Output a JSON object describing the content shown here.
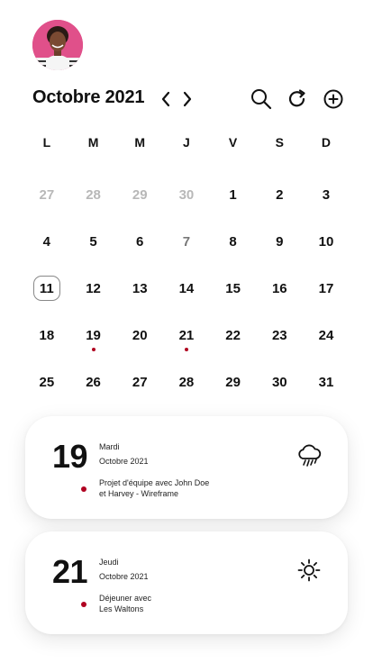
{
  "profile": {
    "avatar": "person-avatar"
  },
  "header": {
    "month_title": "Octobre 2021",
    "icons": [
      "chevron-left-icon",
      "chevron-right-icon",
      "search-icon",
      "refresh-icon",
      "plus-circle-icon"
    ]
  },
  "calendar": {
    "weekdays": [
      "L",
      "M",
      "M",
      "J",
      "V",
      "S",
      "D"
    ],
    "weeks": [
      [
        {
          "label": "27",
          "state": "muted"
        },
        {
          "label": "28",
          "state": "muted"
        },
        {
          "label": "29",
          "state": "muted"
        },
        {
          "label": "30",
          "state": "muted"
        },
        {
          "label": "1",
          "state": "normal"
        },
        {
          "label": "2",
          "state": "normal"
        },
        {
          "label": "3",
          "state": "normal"
        }
      ],
      [
        {
          "label": "4",
          "state": "normal"
        },
        {
          "label": "5",
          "state": "normal"
        },
        {
          "label": "6",
          "state": "normal"
        },
        {
          "label": "7",
          "state": "dim"
        },
        {
          "label": "8",
          "state": "normal"
        },
        {
          "label": "9",
          "state": "normal"
        },
        {
          "label": "10",
          "state": "normal"
        }
      ],
      [
        {
          "label": "11",
          "state": "today"
        },
        {
          "label": "12",
          "state": "normal"
        },
        {
          "label": "13",
          "state": "normal"
        },
        {
          "label": "14",
          "state": "normal"
        },
        {
          "label": "15",
          "state": "normal"
        },
        {
          "label": "16",
          "state": "normal"
        },
        {
          "label": "17",
          "state": "normal"
        }
      ],
      [
        {
          "label": "18",
          "state": "normal"
        },
        {
          "label": "19",
          "state": "normal",
          "has_event": true
        },
        {
          "label": "20",
          "state": "normal"
        },
        {
          "label": "21",
          "state": "normal",
          "has_event": true
        },
        {
          "label": "22",
          "state": "normal"
        },
        {
          "label": "23",
          "state": "normal"
        },
        {
          "label": "24",
          "state": "normal"
        }
      ],
      [
        {
          "label": "25",
          "state": "normal"
        },
        {
          "label": "26",
          "state": "normal"
        },
        {
          "label": "27",
          "state": "normal"
        },
        {
          "label": "28",
          "state": "normal"
        },
        {
          "label": "29",
          "state": "normal"
        },
        {
          "label": "30",
          "state": "normal"
        },
        {
          "label": "31",
          "state": "normal"
        }
      ]
    ]
  },
  "events": [
    {
      "day": "19",
      "weekday": "Mardi",
      "month": "Octobre 2021",
      "desc_line1": "Projet d'équipe avec John Doe",
      "desc_line2": "et Harvey - Wireframe",
      "weather_icon": "rain-cloud-icon"
    },
    {
      "day": "21",
      "weekday": "Jeudi",
      "month": "Octobre 2021",
      "desc_line1": "Déjeuner avec",
      "desc_line2": "Les Waltons",
      "weather_icon": "sun-icon"
    }
  ],
  "colors": {
    "event_dot": "#b00020",
    "avatar_bg": "#e0508a",
    "muted_day": "#b8b8b8",
    "text": "#111111"
  }
}
